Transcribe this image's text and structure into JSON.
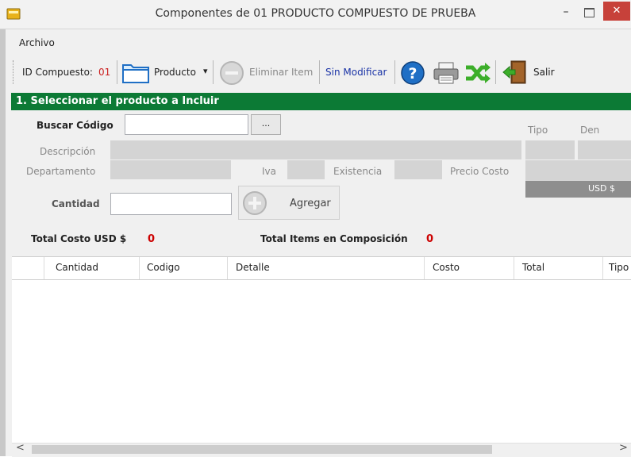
{
  "window": {
    "title": "Componentes de 01 PRODUCTO COMPUESTO DE PRUEBA",
    "minimize": "–",
    "close": "✕"
  },
  "menu": {
    "archivo": "Archivo"
  },
  "toolbar": {
    "id_label": "ID Compuesto:",
    "id_value": "01",
    "producto": "Producto",
    "producto_caret": "▾",
    "eliminar": "Eliminar Item",
    "estado": "Sin Modificar",
    "salir": "Salir"
  },
  "section": {
    "title": "1. Seleccionar el producto a Incluir"
  },
  "form": {
    "buscar_codigo": "Buscar Código",
    "browse": "...",
    "descripcion": "Descripción",
    "departamento": "Departamento",
    "iva": "Iva",
    "existencia": "Existencia",
    "precio_costo": "Precio Costo",
    "tipo": "Tipo",
    "den": "Den",
    "currency": "USD $",
    "cantidad": "Cantidad",
    "agregar": "Agregar"
  },
  "totals": {
    "total_costo_label": "Total Costo USD $",
    "total_costo_value": "0",
    "total_items_label": "Total Items en Composición",
    "total_items_value": "0"
  },
  "grid": {
    "columns": [
      "Cantidad",
      "Codigo",
      "Detalle",
      "Costo",
      "Total",
      "Tipo"
    ]
  },
  "scroll": {
    "left": "<",
    "right": ">"
  },
  "colors": {
    "section_green": "#0c7a35",
    "close_red": "#c7413a",
    "value_red": "#cc0000",
    "link_blue": "#1a33a6"
  }
}
